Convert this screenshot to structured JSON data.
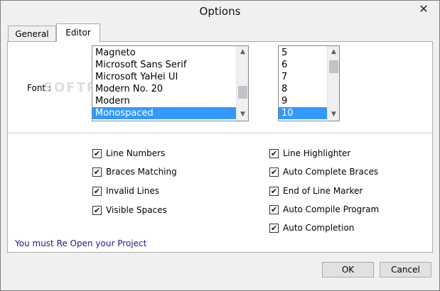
{
  "window": {
    "title": "Options",
    "close_glyph": "✕"
  },
  "tabs": [
    {
      "label": "General",
      "active": false
    },
    {
      "label": "Editor",
      "active": true
    }
  ],
  "font": {
    "label": "Font :",
    "watermark": "SOFTPEDIA",
    "families": [
      "Magneto",
      "Microsoft Sans Serif",
      "Microsoft YaHei UI",
      "Modern No. 20",
      "Modern",
      "Monospaced"
    ],
    "selected_family": "Monospaced",
    "sizes": [
      "5",
      "6",
      "7",
      "8",
      "9",
      "10"
    ],
    "selected_size": "10"
  },
  "options_left": [
    {
      "label": "Line Numbers",
      "checked": true
    },
    {
      "label": "Braces Matching",
      "checked": true
    },
    {
      "label": "Invalid Lines",
      "checked": true
    },
    {
      "label": "Visible Spaces",
      "checked": true
    }
  ],
  "options_right": [
    {
      "label": "Line Highlighter",
      "checked": true
    },
    {
      "label": "Auto Complete Braces",
      "checked": true
    },
    {
      "label": "End of Line Marker",
      "checked": true
    },
    {
      "label": "Auto Compile Program",
      "checked": true
    },
    {
      "label": "Auto Completion",
      "checked": true
    }
  ],
  "notice": "You must Re Open your Project",
  "buttons": {
    "ok": "OK",
    "cancel": "Cancel"
  },
  "icons": {
    "check": "✔",
    "scroll_up": "▲",
    "scroll_down": "▼"
  },
  "colors": {
    "selection": "#3399ff",
    "notice_text": "#1a1a8c"
  }
}
